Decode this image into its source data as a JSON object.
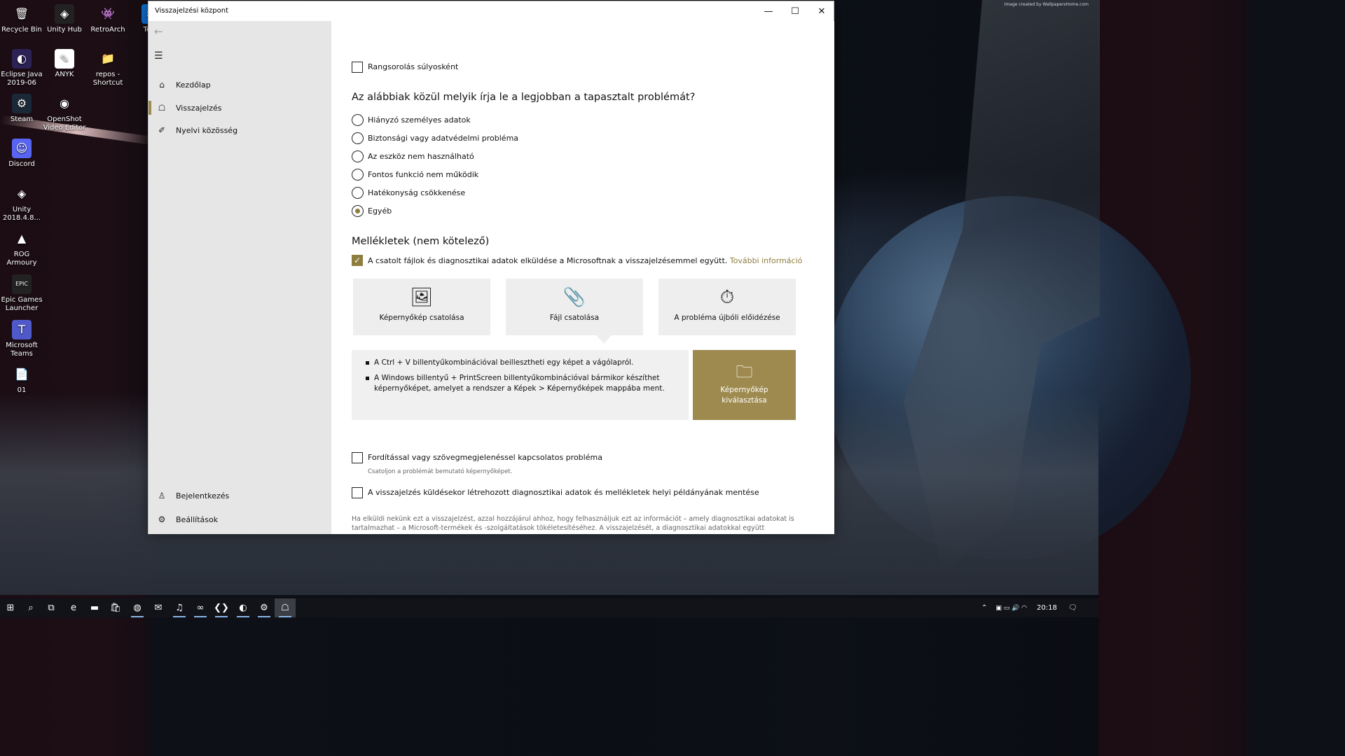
{
  "desktop": {
    "watermark": "Image created by WallpapersHome.com",
    "icons": [
      {
        "label": "Recycle Bin",
        "icon": "recycle-bin-icon",
        "glyph": "🗑",
        "bg": "transparent"
      },
      {
        "label": "Unity Hub",
        "icon": "unity-hub-icon",
        "glyph": "◈",
        "bg": "#222"
      },
      {
        "label": "RetroArch",
        "icon": "retroarch-icon",
        "glyph": "👾",
        "bg": "transparent"
      },
      {
        "label": "Tean",
        "icon": "teamviewer-icon",
        "glyph": "⇄",
        "bg": "#0e6fd1"
      },
      {
        "label": "Eclipse Java 2019-06",
        "icon": "eclipse-icon",
        "glyph": "◐",
        "bg": "#2c2255"
      },
      {
        "label": "ANYK",
        "icon": "anyk-icon",
        "glyph": "✎",
        "bg": "#fff"
      },
      {
        "label": "repos - Shortcut",
        "icon": "folder-shortcut-icon",
        "glyph": "📁",
        "bg": "transparent"
      },
      {
        "label": "Steam",
        "icon": "steam-icon",
        "glyph": "⚙",
        "bg": "#1b2838"
      },
      {
        "label": "OpenShot Video Editor",
        "icon": "openshot-icon",
        "glyph": "◉",
        "bg": "transparent"
      },
      {
        "label": "Discord",
        "icon": "discord-icon",
        "glyph": "☺",
        "bg": "#5865f2"
      },
      {
        "label": "Unity 2018.4.8...",
        "icon": "unity-icon",
        "glyph": "◈",
        "bg": "transparent"
      },
      {
        "label": "ROG Armoury",
        "icon": "rog-armoury-icon",
        "glyph": "▲",
        "bg": "transparent"
      },
      {
        "label": "Epic Games Launcher",
        "icon": "epic-games-icon",
        "glyph": "EPIC",
        "bg": "#222"
      },
      {
        "label": "Microsoft Teams",
        "icon": "teams-icon",
        "glyph": "T",
        "bg": "#5059c9"
      },
      {
        "label": "01",
        "icon": "document-file-icon",
        "glyph": "📄",
        "bg": "transparent"
      }
    ]
  },
  "window": {
    "title": "Visszajelzési központ",
    "minimize_glyph": "—",
    "maximize_glyph": "☐",
    "close_glyph": "✕"
  },
  "sidebar": {
    "back_glyph": "←",
    "menu_glyph": "☰",
    "items": [
      {
        "label": "Kezdőlap",
        "icon": "home-icon",
        "glyph": "⌂"
      },
      {
        "label": "Visszajelzés",
        "icon": "feedback-icon",
        "glyph": "☖"
      },
      {
        "label": "Nyelvi közösség",
        "icon": "language-community-icon",
        "glyph": "✐"
      }
    ],
    "bottom_items": [
      {
        "label": "Bejelentkezés",
        "icon": "person-icon",
        "glyph": "♙"
      },
      {
        "label": "Beállítások",
        "icon": "gear-icon",
        "glyph": "⚙"
      }
    ]
  },
  "main": {
    "rank_as_severity": {
      "label": "Rangsorolás súlyosként",
      "checked": false
    },
    "question": "Az alábbiak közül melyik írja le a legjobban a tapasztalt problémát?",
    "options": [
      {
        "label": "Hiányzó személyes adatok",
        "selected": false
      },
      {
        "label": "Biztonsági vagy adatvédelmi probléma",
        "selected": false
      },
      {
        "label": "Az eszköz nem használható",
        "selected": false
      },
      {
        "label": "Fontos funkció nem működik",
        "selected": false
      },
      {
        "label": "Hatékonyság csökkenése",
        "selected": false
      },
      {
        "label": "Egyéb",
        "selected": true
      }
    ],
    "attachments_heading": "Mellékletek (nem kötelező)",
    "send_diag": {
      "checked": true,
      "label": "A csatolt fájlok és diagnosztikai adatok elküldése a Microsoftnak a visszajelzésemmel együtt.",
      "link": "További információ",
      "check_glyph": "✓"
    },
    "tiles": [
      {
        "label": "Képernyőkép csatolása",
        "icon": "screenshot-icon",
        "glyph": "🖼"
      },
      {
        "label": "Fájl csatolása",
        "icon": "paperclip-icon",
        "glyph": "📎"
      },
      {
        "label": "A probléma újbóli előidézése",
        "icon": "timer-record-icon",
        "glyph": "⏱"
      }
    ],
    "info_bullets": [
      "A Ctrl + V billentyűkombinációval beillesztheti egy képet a vágólapról.",
      "A Windows billentyű + PrintScreen billentyűkombinációval bármikor készíthet képernyőképet, amelyet a rendszer a Képek > Képernyőképek mappába ment."
    ],
    "pick_screenshot": {
      "label": "Képernyőkép kiválasztása",
      "glyph": "🗀"
    },
    "translation_issue": {
      "label": "Fordítással vagy szövegmegjelenéssel kapcsolatos probléma",
      "hint": "Csatoljon a problémát bemutató képernyőképet.",
      "checked": false
    },
    "save_local_copy": {
      "label": "A visszajelzés küldésekor létrehozott diagnosztikai adatok és mellékletek helyi példányának mentése",
      "checked": false
    },
    "legal_text": "Ha elküldi nekünk ezt a visszajelzést, azzal hozzájárul ahhoz, hogy felhasználjuk ezt az információt – amely diagnosztikai adatokat is tartalmazhat – a Microsoft-termékek és -szolgáltatások tökéletesítéséhez. A visszajelzését, a diagnosztikai adatokkal együtt"
  },
  "taskbar": {
    "items": [
      {
        "icon": "windows-start-icon",
        "glyph": "⊞"
      },
      {
        "icon": "search-icon",
        "glyph": "⌕"
      },
      {
        "icon": "task-view-icon",
        "glyph": "⧉"
      },
      {
        "icon": "edge-icon",
        "glyph": "e"
      },
      {
        "icon": "file-explorer-icon",
        "glyph": "▬"
      },
      {
        "icon": "store-icon",
        "glyph": "🛍"
      },
      {
        "icon": "chrome-icon",
        "glyph": "◍"
      },
      {
        "icon": "mail-icon",
        "glyph": "✉"
      },
      {
        "icon": "spotify-icon",
        "glyph": "♫"
      },
      {
        "icon": "visual-studio-icon",
        "glyph": "∞"
      },
      {
        "icon": "vscode-icon",
        "glyph": "❮❯"
      },
      {
        "icon": "app-icon",
        "glyph": "◐"
      },
      {
        "icon": "settings-icon",
        "glyph": "⚙"
      },
      {
        "icon": "feedback-hub-icon",
        "glyph": "☖"
      }
    ],
    "tray": {
      "chevron_glyph": "⌃",
      "clock": "20:18",
      "notification_glyph": "🗨"
    }
  }
}
